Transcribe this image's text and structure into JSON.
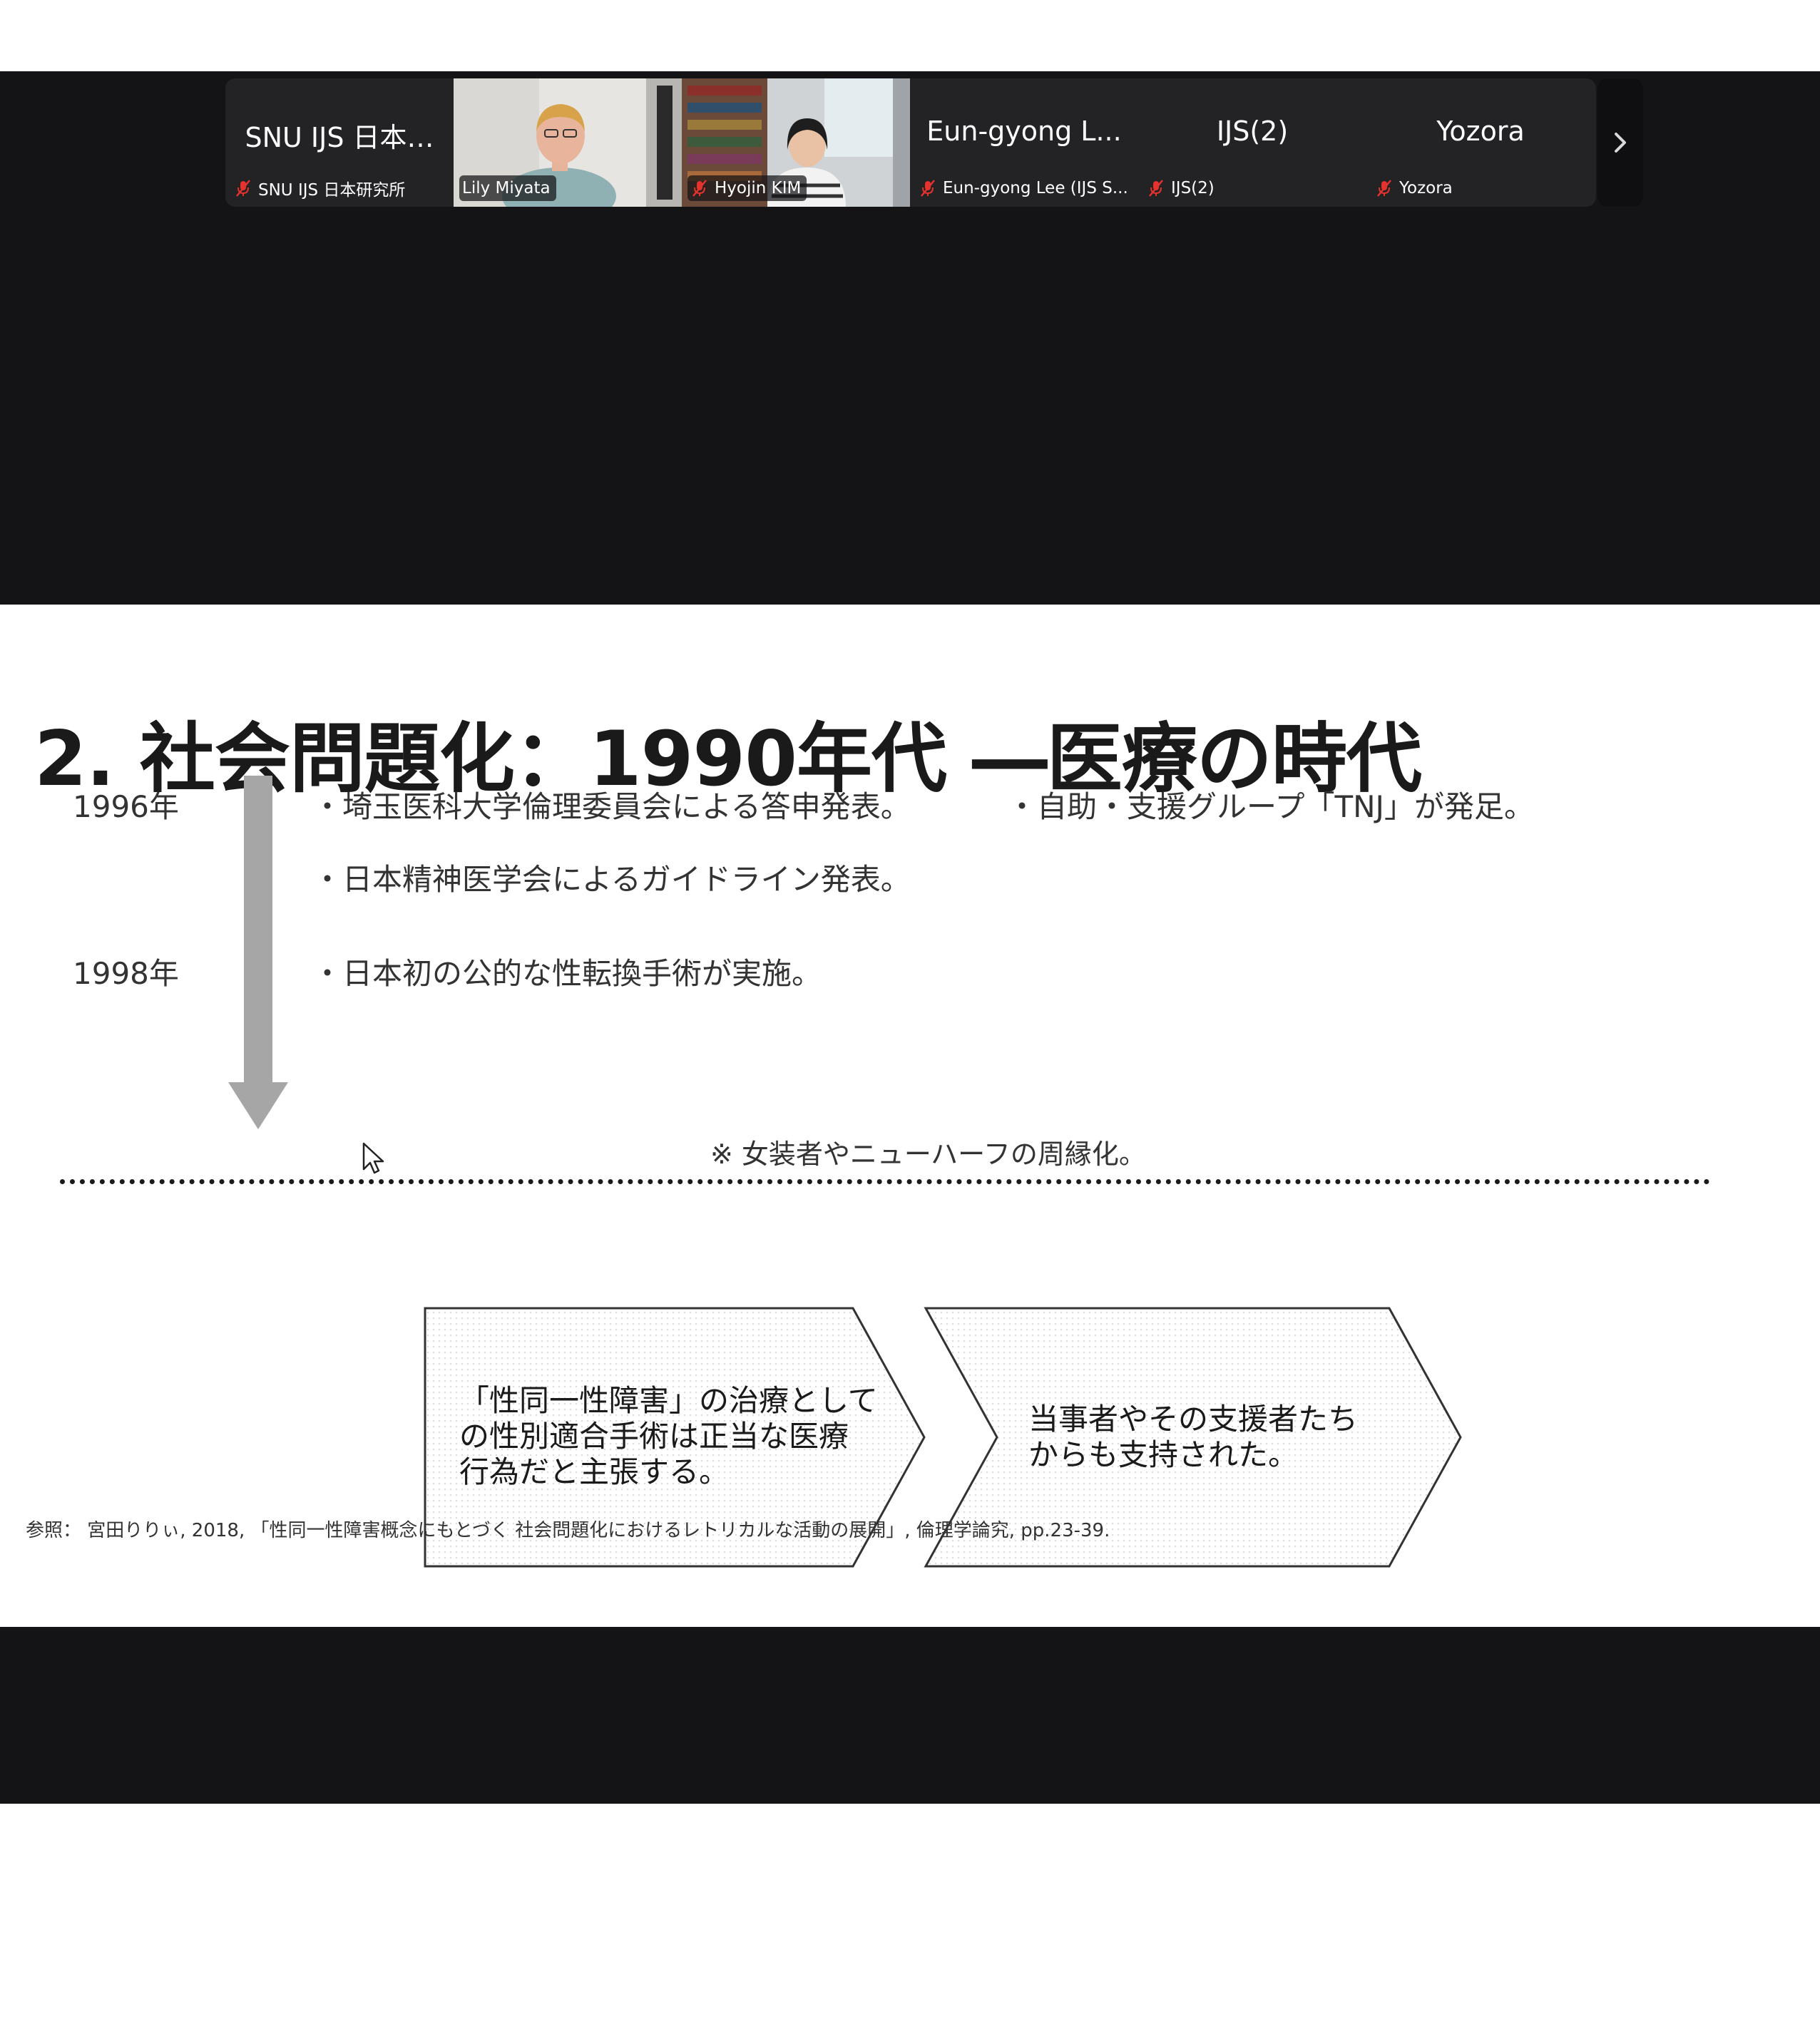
{
  "participants": [
    {
      "display": "SNU IJS 日本…",
      "name": "SNU IJS 日本研究所",
      "muted": true,
      "video": false
    },
    {
      "display": "",
      "name": "Lily Miyata",
      "muted": false,
      "video": true,
      "active": true
    },
    {
      "display": "",
      "name": "Hyojin KIM",
      "muted": true,
      "video": true
    },
    {
      "display": "Eun-gyong L...",
      "name": "Eun-gyong Lee (IJS S...",
      "muted": true,
      "video": false
    },
    {
      "display": "IJS(2)",
      "name": "IJS(2)",
      "muted": true,
      "video": false
    },
    {
      "display": "Yozora",
      "name": "Yozora",
      "muted": true,
      "video": false
    }
  ],
  "next_icon": "chevron-right-icon",
  "slide": {
    "title": "2. 社会問題化：1990年代 ―医療の時代",
    "years": [
      "1996年",
      "1998年"
    ],
    "items": [
      "・埼玉医科大学倫理委員会による答申発表。",
      "・自助・支援グループ「TNJ」が発足。",
      "・日本精神医学会によるガイドライン発表。",
      "・日本初の公的な性転換手術が実施。"
    ],
    "note": "※ 女装者やニューハーフの周縁化。",
    "chevron1": [
      "「性同一性障害」の治療として",
      "の性別適合手術は正当な医療",
      "行為だと主張する。"
    ],
    "chevron2": [
      "当事者やその支援者たち",
      "からも支持された。"
    ],
    "reference": "参照： 宮田りりぃ, 2018, 「性同一性障害概念にもとづく 社会問題化におけるレトリカルな活動の展開」, 倫理学論究, pp.23-39."
  },
  "colors": {
    "active_border": "#31c24a",
    "muted_mic": "#e5322d",
    "zoom_bg": "#141416",
    "tile_bg": "#232326"
  }
}
